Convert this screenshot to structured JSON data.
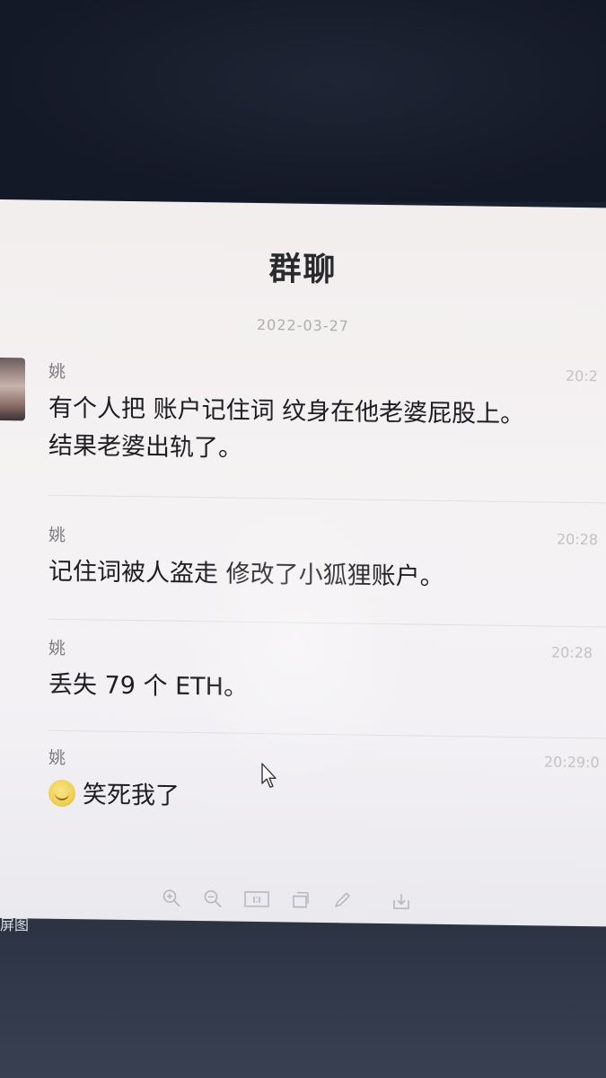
{
  "window": {
    "title": "群聊",
    "date": "2022-03-27"
  },
  "messages": [
    {
      "sender": "姚",
      "time": "20:2",
      "lines": [
        "有个人把 账户记住词 纹身在他老婆屁股上。",
        "结果老婆出轨了。"
      ]
    },
    {
      "sender": "姚",
      "time": "20:28",
      "lines": [
        "记住词被人盗走 修改了小狐狸账户。"
      ]
    },
    {
      "sender": "姚",
      "time": "20:28",
      "lines": [
        "丢失 79 个 ETH。"
      ]
    },
    {
      "sender": "姚",
      "time": "20:29:0",
      "emoji": "grin-emoji",
      "lines": [
        "笑死我了"
      ]
    }
  ],
  "toolbar": {
    "icons": [
      "zoom-in-icon",
      "zoom-out-icon",
      "actual-size-icon",
      "crop-icon",
      "pen-icon",
      "download-icon"
    ]
  },
  "desktop": {
    "corner_label": "屏图"
  }
}
